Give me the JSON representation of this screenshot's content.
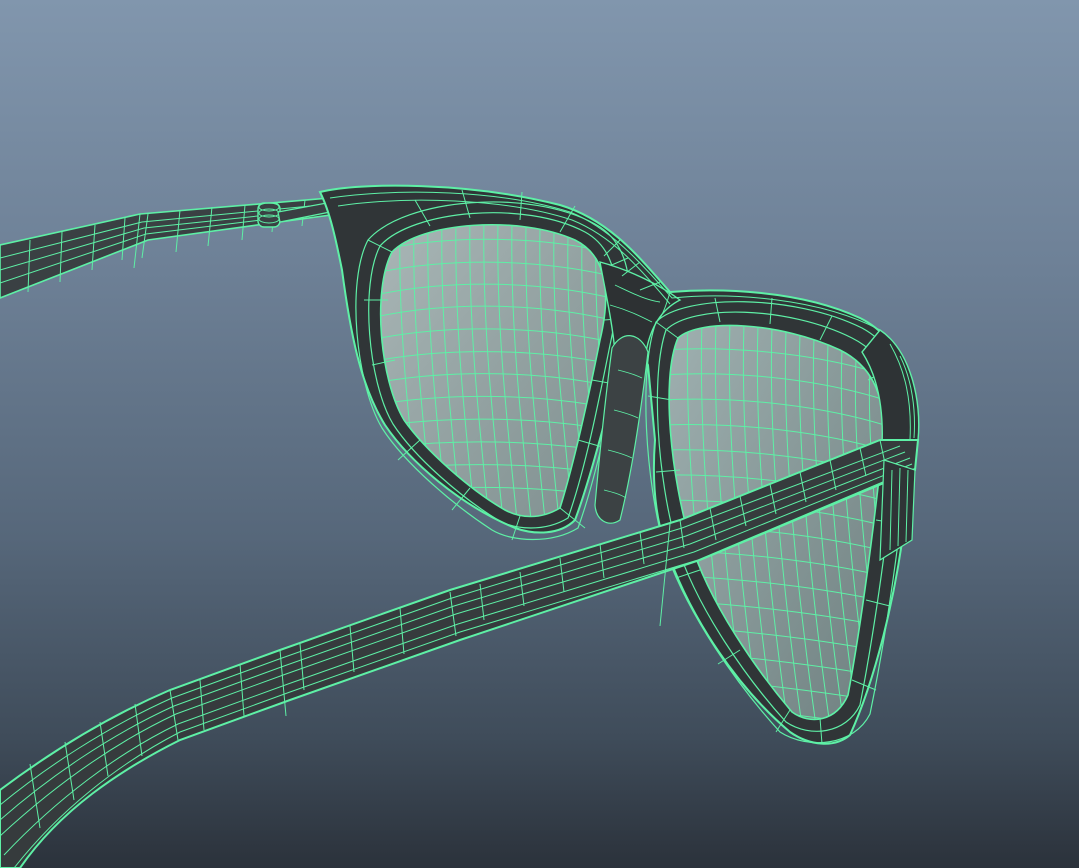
{
  "viewport": {
    "background_top": "#8196ad",
    "background_bottom": "#2b323b"
  },
  "model": {
    "subject": "glasses",
    "display_mode": "wireframe-on-shaded",
    "wire_color": "#5ef0a6",
    "wire_dark_color": "#2fbf7a",
    "shell_color": "#33383a",
    "lens_color": "#8fa3a3"
  }
}
